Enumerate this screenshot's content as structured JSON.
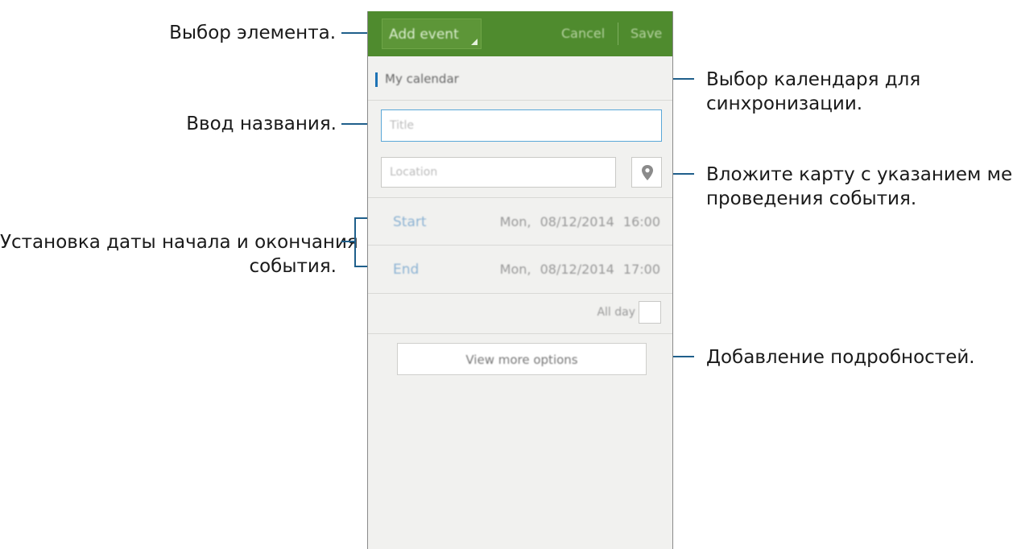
{
  "annotations": {
    "select_item": "Выбор элемента.",
    "enter_title": "Ввод названия.",
    "set_dates_line1": "Установка даты начала и окончания",
    "set_dates_line2": "события.",
    "select_calendar_line1": "Выбор календаря для",
    "select_calendar_line2": "синхронизации.",
    "attach_map_line1": "Вложите карту с указанием места",
    "attach_map_line2": "проведения события.",
    "add_details": "Добавление подробностей."
  },
  "app": {
    "header": {
      "type_selector": "Add event",
      "cancel": "Cancel",
      "save": "Save"
    },
    "calendar": "My calendar",
    "title_field": {
      "placeholder": "Title",
      "value": ""
    },
    "location_field": {
      "placeholder": "Location",
      "value": ""
    },
    "start": {
      "label": "Start",
      "date": "Mon, 08/12/2014",
      "time": "16:00"
    },
    "end": {
      "label": "End",
      "date": "Mon, 08/12/2014",
      "time": "17:00"
    },
    "all_day": {
      "label": "All day",
      "checked": false
    },
    "more_options": "View more options"
  },
  "icons": {
    "location": "map-pin-icon"
  },
  "colors": {
    "header_bg": "#4f8b2e",
    "accent_blue": "#1e73b5",
    "callout_line": "#1f5f8b",
    "screen_bg": "#f1f1ef"
  }
}
